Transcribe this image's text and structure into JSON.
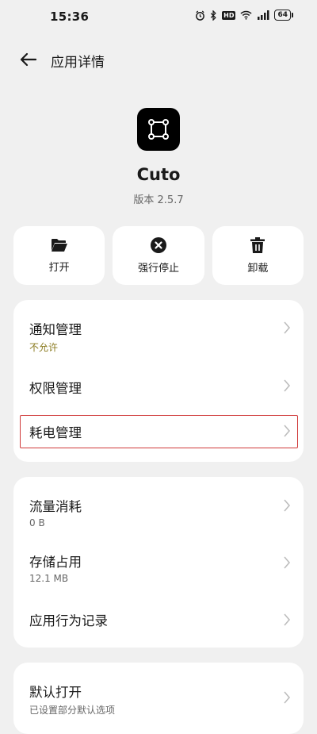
{
  "status_bar": {
    "time": "15:36",
    "hd": "HD",
    "signal": "4G",
    "battery": "64"
  },
  "header": {
    "title": "应用详情"
  },
  "app": {
    "name": "Cuto",
    "version": "版本 2.5.7"
  },
  "actions": [
    {
      "label": "打开",
      "icon": "folder-open-icon"
    },
    {
      "label": "强行停止",
      "icon": "force-stop-icon"
    },
    {
      "label": "卸载",
      "icon": "trash-icon"
    }
  ],
  "card1": {
    "notification": {
      "title": "通知管理",
      "sub": "不允许",
      "sub_color": "#8a7a1f"
    },
    "permissions": {
      "title": "权限管理"
    },
    "battery": {
      "title": "耗电管理"
    }
  },
  "card2": {
    "traffic": {
      "title": "流量消耗",
      "sub": "0 B"
    },
    "storage": {
      "title": "存储占用",
      "sub": "12.1 MB"
    },
    "behavior": {
      "title": "应用行为记录"
    }
  },
  "card3": {
    "default_open": {
      "title": "默认打开",
      "sub": "已设置部分默认选项"
    }
  },
  "colors": {
    "background": "#f0f0f0",
    "card": "#ffffff",
    "highlight": "#d03a3a",
    "accent_sub": "#8a7a1f"
  }
}
